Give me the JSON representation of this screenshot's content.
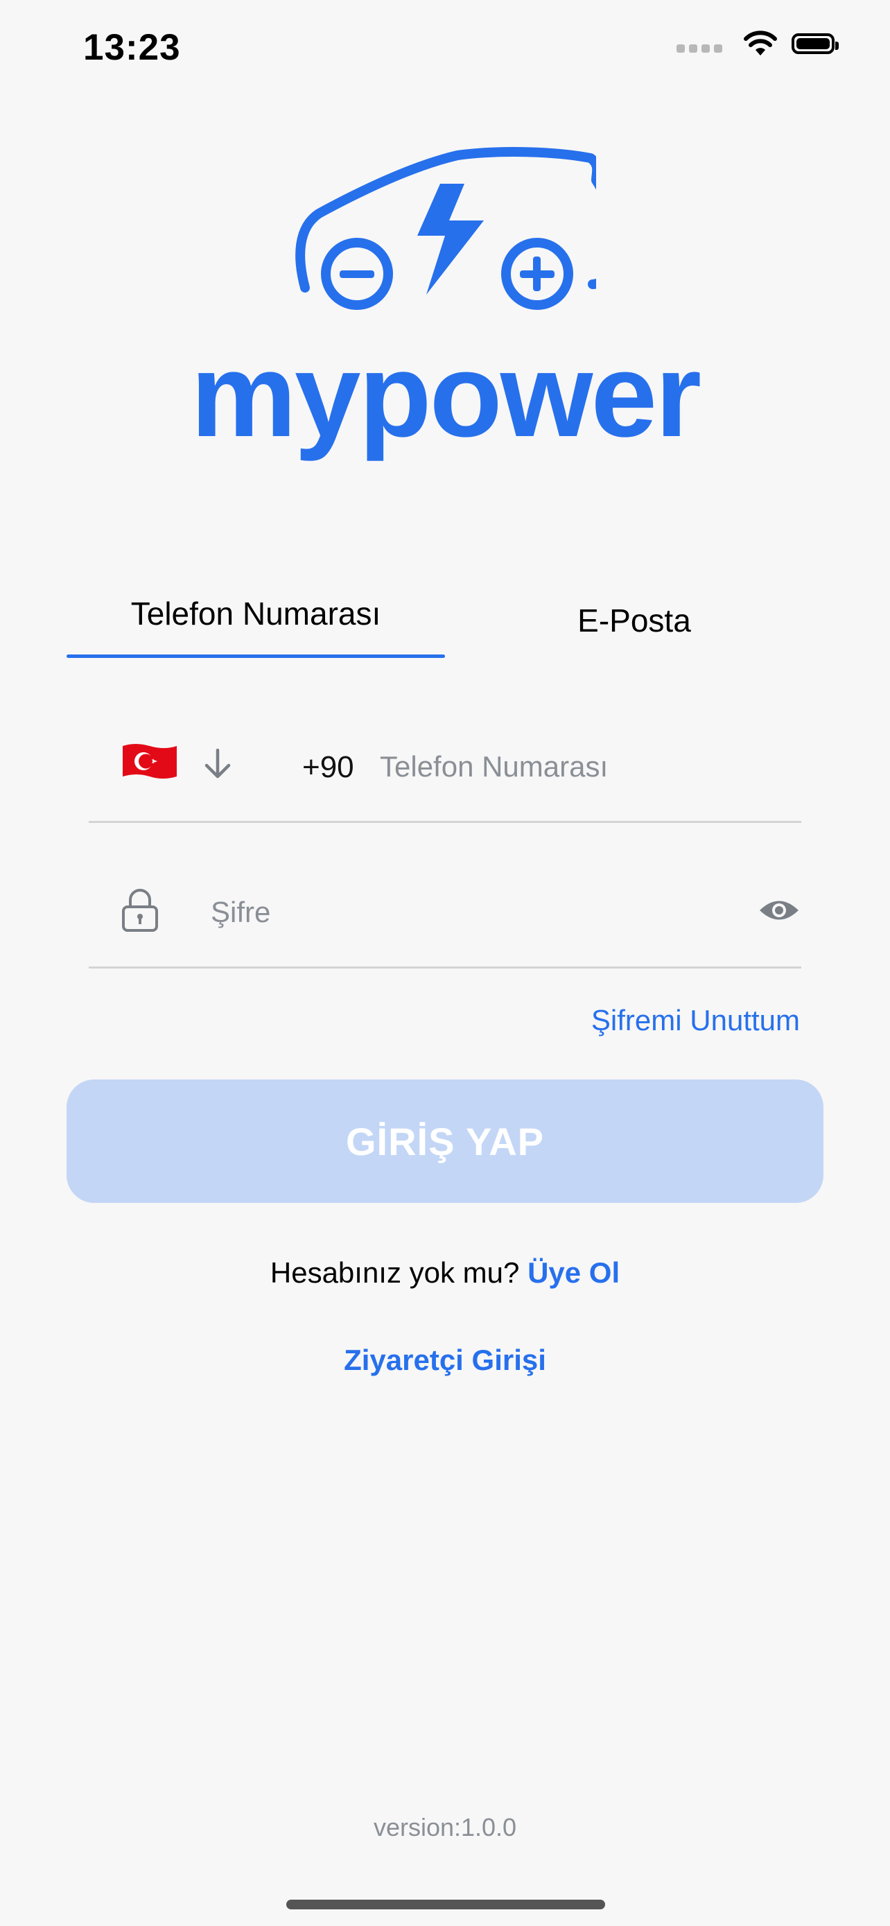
{
  "status_bar": {
    "time": "13:23",
    "icons": [
      "signal-icon",
      "wifi-icon",
      "battery-icon"
    ]
  },
  "brand": {
    "name": "mypower",
    "color": "#2770ec"
  },
  "tabs": [
    {
      "label": "Telefon Numarası",
      "active": true
    },
    {
      "label": "E-Posta",
      "active": false
    }
  ],
  "phone_field": {
    "country_flag": "flag-turkey-icon",
    "dial_code": "+90",
    "placeholder": "Telefon Numarası"
  },
  "password_field": {
    "placeholder": "Şifre"
  },
  "forgot_password": "Şifremi Unuttum",
  "login_button": "GİRİŞ YAP",
  "signup": {
    "prompt": "Hesabınız yok mu?",
    "link": "Üye Ol"
  },
  "guest_login": "Ziyaretçi Girişi",
  "version": "version:1.0.0",
  "colors": {
    "accent": "#2770ec",
    "button_disabled": "#c3d6f6",
    "background": "#f7f7f7"
  }
}
